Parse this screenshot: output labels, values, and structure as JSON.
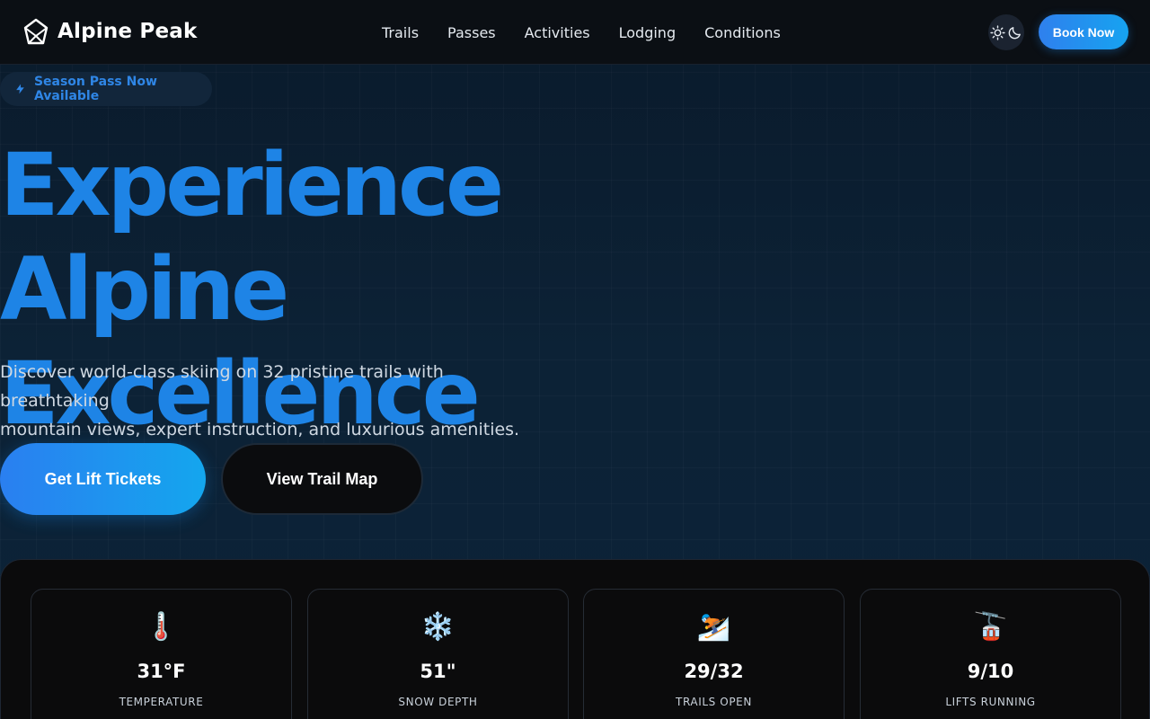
{
  "header": {
    "brand": "Alpine Peak",
    "nav": [
      "Trails",
      "Passes",
      "Activities",
      "Lodging",
      "Conditions"
    ],
    "book_label": "Book Now"
  },
  "hero": {
    "badge": "Season Pass Now Available",
    "title_line1": "Experience Alpine",
    "title_line2": "Excellence",
    "subtitle_line1": "Discover world-class skiing on 32 pristine trails with breathtaking",
    "subtitle_line2": "mountain views, expert instruction, and luxurious amenities.",
    "primary_cta": "Get Lift Tickets",
    "secondary_cta": "View Trail Map"
  },
  "stats": [
    {
      "icon": "🌡️",
      "icon_name": "thermometer-icon",
      "value": "31°F",
      "label": "TEMPERATURE"
    },
    {
      "icon": "❄️",
      "icon_name": "snowflake-icon",
      "value": "51\"",
      "label": "SNOW DEPTH"
    },
    {
      "icon": "⛷️",
      "icon_name": "skier-icon",
      "value": "29/32",
      "label": "TRAILS OPEN"
    },
    {
      "icon": "🚡",
      "icon_name": "gondola-icon",
      "value": "9/10",
      "label": "LIFTS RUNNING"
    }
  ],
  "colors": {
    "accent": "#1e84e6",
    "header_bg": "#0b0f14",
    "panel_bg": "#0b0b0c"
  }
}
